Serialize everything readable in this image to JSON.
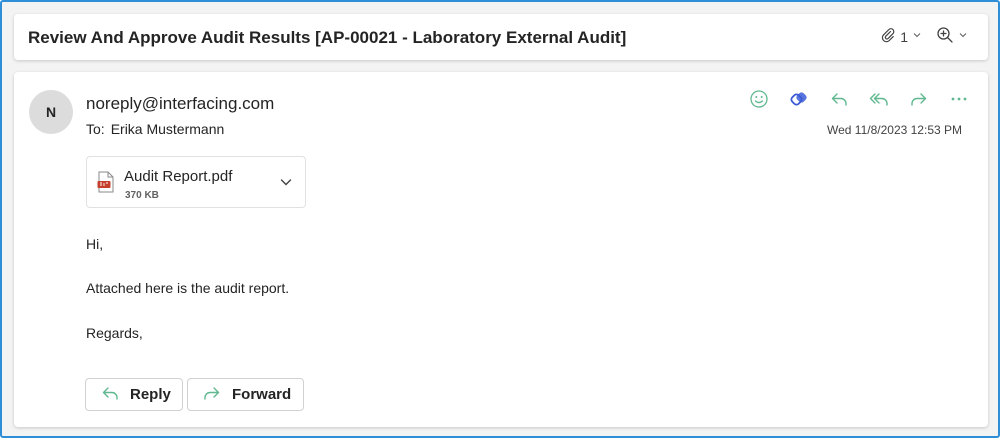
{
  "subject": "Review And Approve Audit Results [AP-00021 - Laboratory External Audit]",
  "header_tools": {
    "attachment_count": "1"
  },
  "message": {
    "avatar_initial": "N",
    "sender": "noreply@interfacing.com",
    "to_label": "To:",
    "to_name": "Erika Mustermann",
    "date": "Wed 11/8/2023 12:53 PM",
    "actions": [
      "smiley-icon",
      "loop-icon",
      "reply-icon",
      "reply-all-icon",
      "forward-icon",
      "more-icon"
    ],
    "attachment": {
      "name": "Audit Report.pdf",
      "size": "370 KB"
    },
    "body": [
      "Hi,",
      "Attached here is the audit report.",
      "Regards,"
    ]
  },
  "buttons": {
    "reply": "Reply",
    "forward": "Forward"
  },
  "colors": {
    "accent": "#2f8fd6",
    "action_green": "#5fb88f",
    "loop_blue": "#3b5bd6",
    "pdf_red": "#c4402d"
  }
}
